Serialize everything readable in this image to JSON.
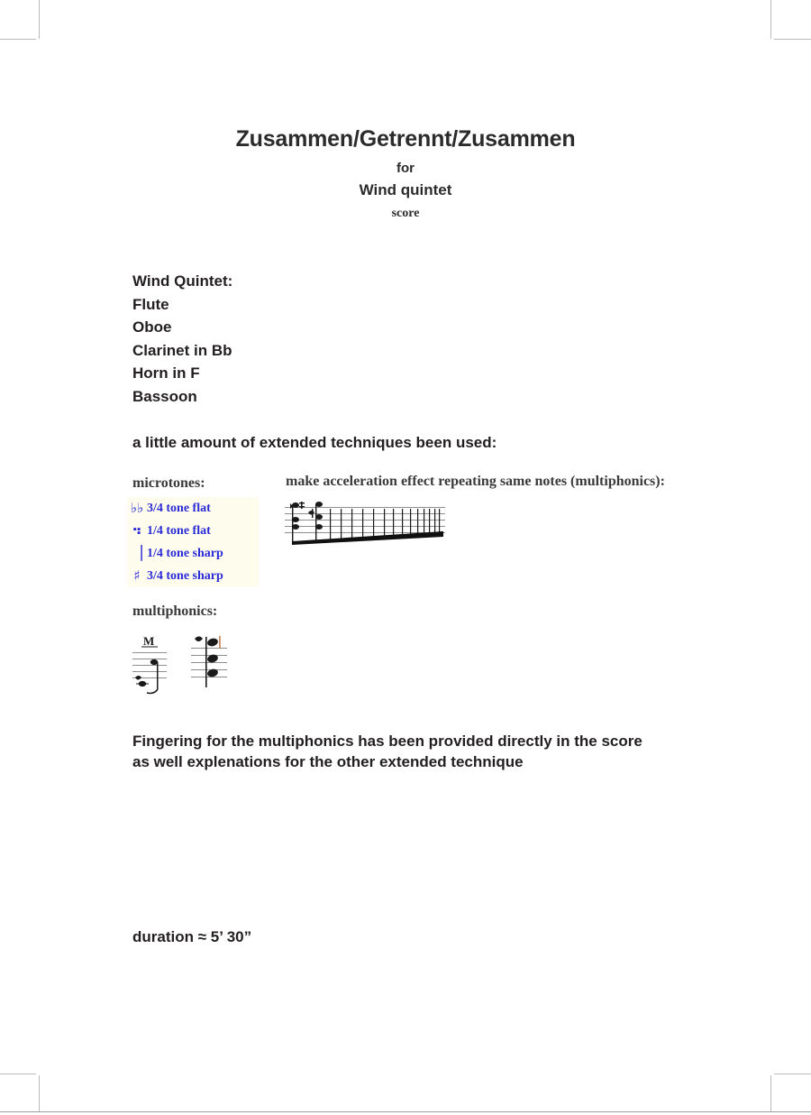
{
  "document": {
    "title": "Zusammen/Getrennt/Zusammen",
    "for_label": "for",
    "ensemble": "Wind quintet",
    "doc_type": "score"
  },
  "instrumentation": {
    "heading": "Wind Quintet:",
    "instruments": [
      "Flute",
      "Oboe",
      "Clarinet in Bb",
      "Horn in F",
      "Bassoon"
    ]
  },
  "techniques": {
    "intro": "a little amount of extended techniques been used:",
    "microtones_heading": "microtones:",
    "acceleration_heading": "make acceleration effect repeating same notes (multiphonics):",
    "multiphonics_heading": "multiphonics:",
    "microtone_legend": [
      {
        "glyph": "♭♭",
        "name": "three-quarter-tone-flat-icon",
        "label": "3/4 tone flat"
      },
      {
        "glyph": "⠲",
        "name": "quarter-tone-flat-icon",
        "label": "1/4 tone flat"
      },
      {
        "glyph": "▕",
        "name": "quarter-tone-sharp-icon",
        "label": "1/4 tone sharp"
      },
      {
        "glyph": "♯",
        "name": "three-quarter-tone-sharp-icon",
        "label": "3/4 tone sharp"
      }
    ],
    "legend_text_color": "#2b2bd8",
    "legend_background_color": "#fdfced"
  },
  "closing": {
    "line_1": "Fingering for the multiphonics has been provided directly in the score",
    "line_2": "as well explenations for the other extended technique"
  },
  "duration": {
    "text": "duration ≈ 5’ 30”"
  }
}
